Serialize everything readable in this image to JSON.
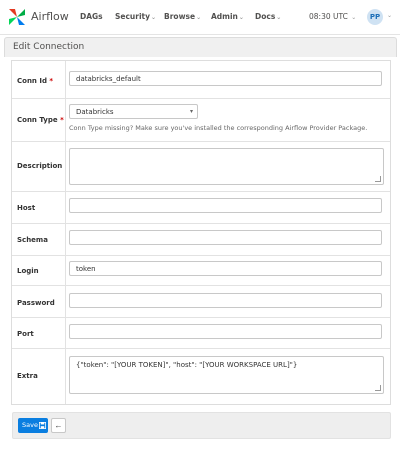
{
  "navbar": {
    "brand": "Airflow",
    "items": [
      {
        "label": "DAGs",
        "caret": false
      },
      {
        "label": "Security",
        "caret": true
      },
      {
        "label": "Browse",
        "caret": true
      },
      {
        "label": "Admin",
        "caret": true
      },
      {
        "label": "Docs",
        "caret": true
      }
    ],
    "time": "08:30 UTC",
    "user_initials": "PP"
  },
  "panel": {
    "title": "Edit Connection"
  },
  "form": {
    "conn_id": {
      "label": "Conn Id",
      "required": "*",
      "value": "databricks_default"
    },
    "conn_type": {
      "label": "Conn Type",
      "required": "*",
      "value": "Databricks",
      "help": "Conn Type missing? Make sure you've installed the corresponding Airflow Provider Package."
    },
    "description": {
      "label": "Description",
      "value": ""
    },
    "host": {
      "label": "Host",
      "value": ""
    },
    "schema": {
      "label": "Schema",
      "value": ""
    },
    "login": {
      "label": "Login",
      "value": "token"
    },
    "password": {
      "label": "Password",
      "value": ""
    },
    "port": {
      "label": "Port",
      "value": ""
    },
    "extra": {
      "label": "Extra",
      "value": "{\"token\": \"[YOUR TOKEN]\", \"host\": \"[YOUR WORKSPACE URL]\"}"
    }
  },
  "footer": {
    "save_label": "Save",
    "back_icon": "←"
  },
  "colors": {
    "primary": "#0a7ee0",
    "required": "#cc0000"
  },
  "icons": [
    "airflow-logo-icon",
    "save-icon",
    "back-arrow-icon",
    "chevron-down-icon"
  ]
}
